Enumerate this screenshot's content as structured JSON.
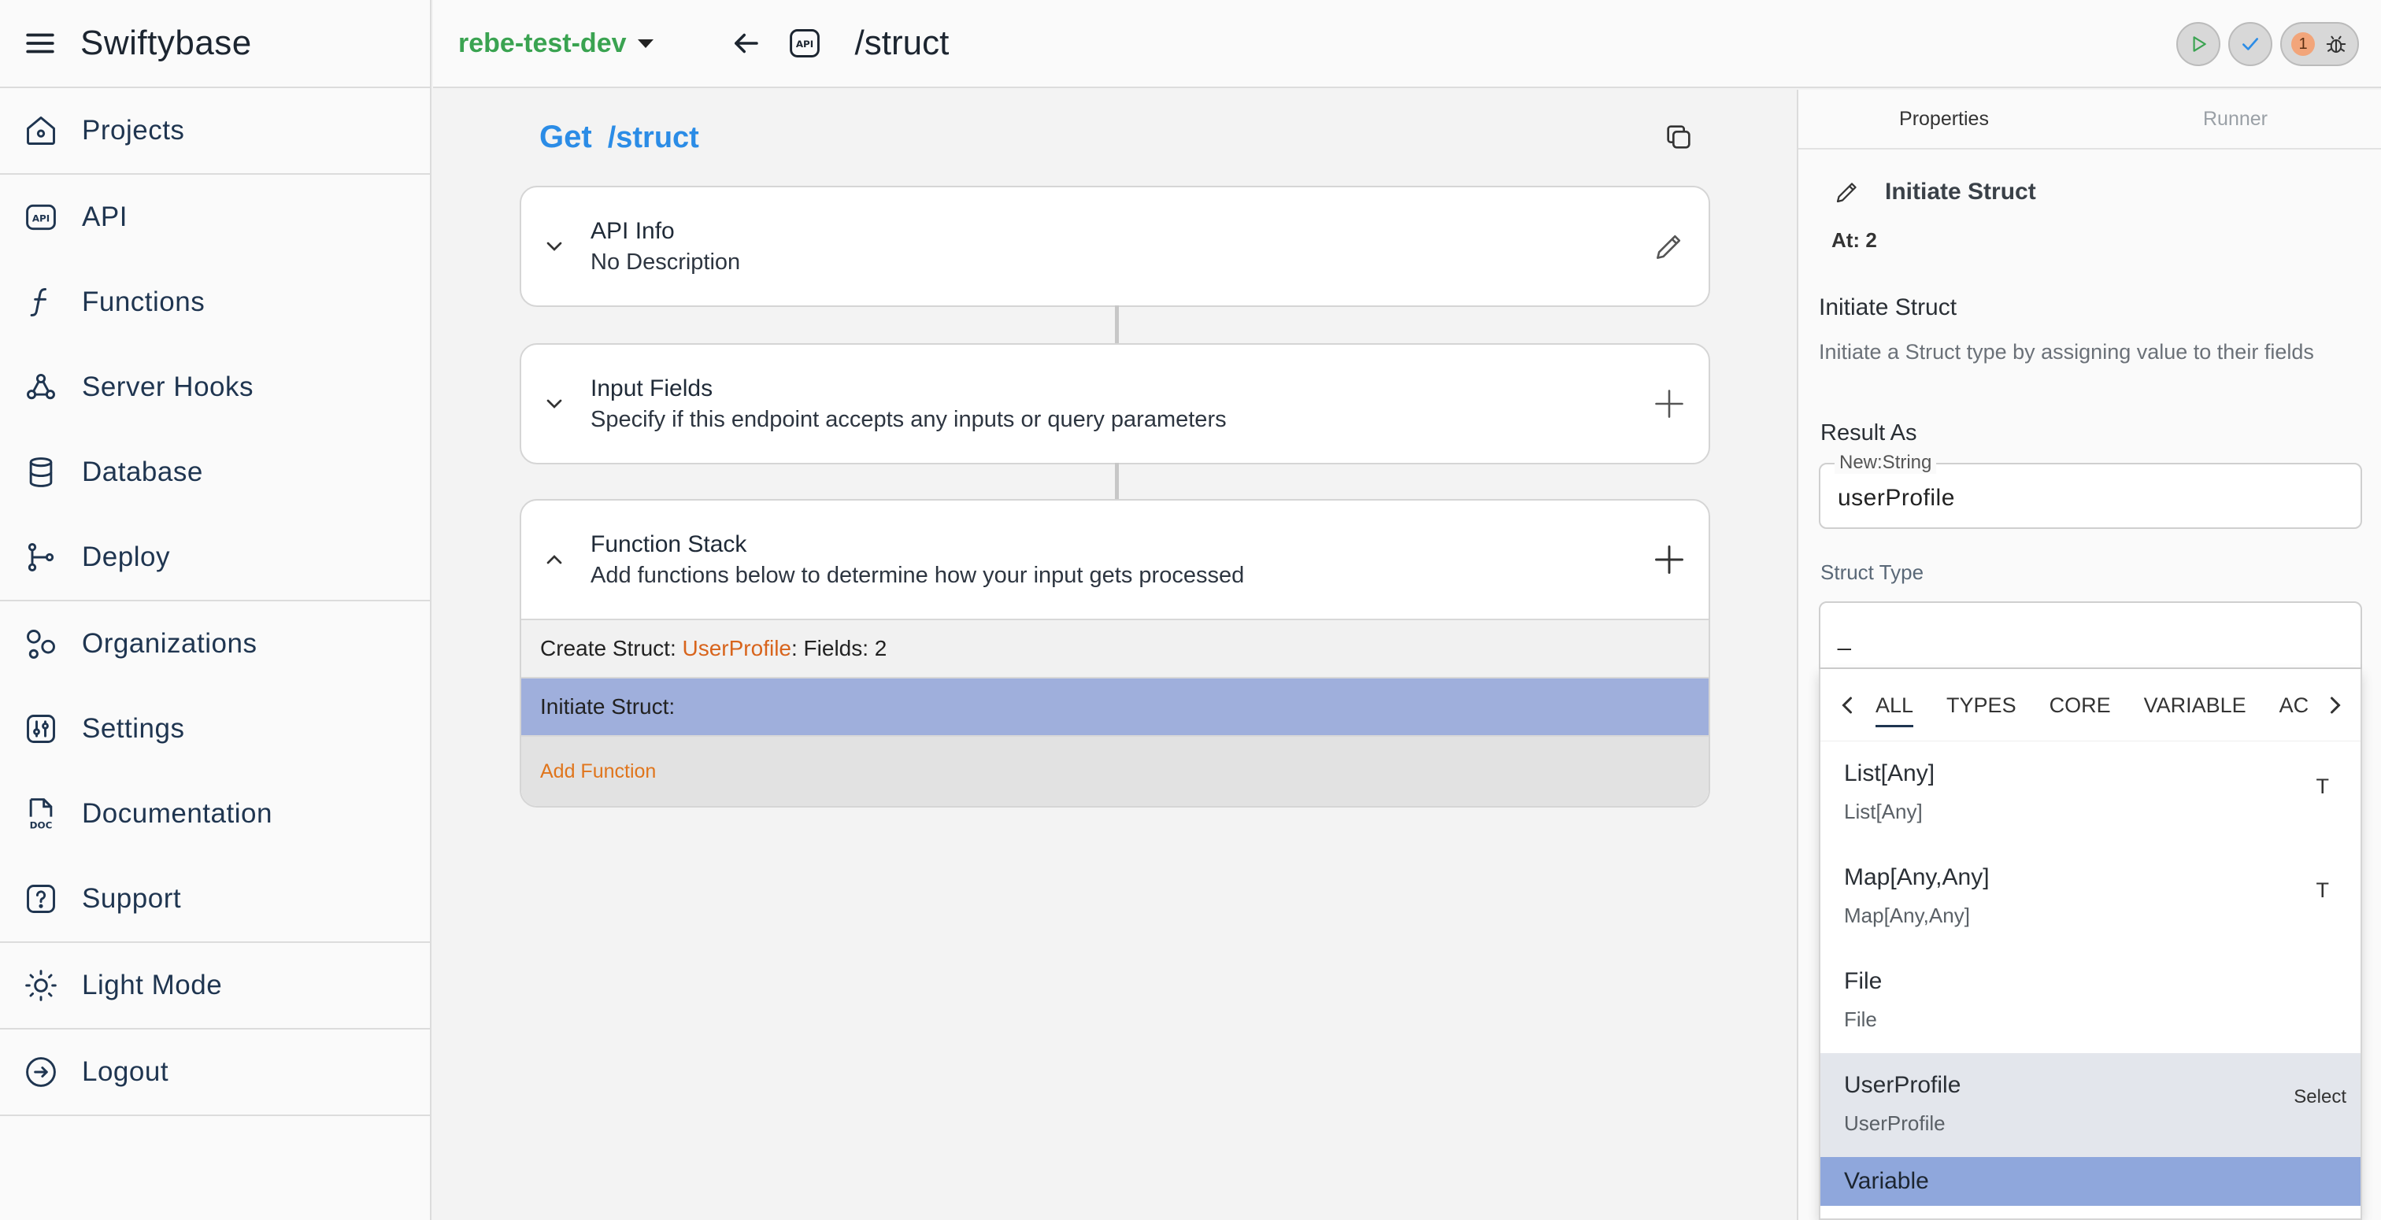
{
  "app": {
    "name": "Swiftybase"
  },
  "sidebar": {
    "items": [
      {
        "label": "Projects",
        "icon": "home-icon"
      },
      {
        "label": "API",
        "icon": "api-icon"
      },
      {
        "label": "Functions",
        "icon": "function-icon"
      },
      {
        "label": "Server Hooks",
        "icon": "webhook-icon"
      },
      {
        "label": "Database",
        "icon": "database-icon"
      },
      {
        "label": "Deploy",
        "icon": "git-branch-icon"
      },
      {
        "label": "Organizations",
        "icon": "organizations-icon"
      },
      {
        "label": "Settings",
        "icon": "settings-icon"
      },
      {
        "label": "Documentation",
        "icon": "doc-icon"
      },
      {
        "label": "Support",
        "icon": "help-icon"
      },
      {
        "label": "Light Mode",
        "icon": "sun-icon"
      },
      {
        "label": "Logout",
        "icon": "logout-icon"
      }
    ]
  },
  "topbar": {
    "environment": "rebe-test-dev",
    "path": "/struct",
    "notification_count": "1"
  },
  "endpoint": {
    "method": "Get",
    "path": "/struct"
  },
  "cards": {
    "api_info": {
      "title": "API Info",
      "subtitle": "No Description"
    },
    "input_fields": {
      "title": "Input Fields",
      "subtitle": "Specify if this endpoint accepts any inputs or query parameters"
    },
    "function_stack": {
      "title": "Function Stack",
      "subtitle": "Add functions below to determine how your input gets processed",
      "rows": {
        "create_prefix": "Create Struct: ",
        "create_struct_name": "UserProfile",
        "create_suffix": ": Fields: 2",
        "initiate": "Initiate Struct:"
      },
      "add_label": "Add Function"
    }
  },
  "panel": {
    "tabs": [
      "Properties",
      "Runner"
    ],
    "header_title": "Initiate Struct",
    "at": "At: 2",
    "function_name": "Initiate Struct",
    "function_desc": "Initiate a Struct type by assigning value to their fields",
    "result_label": "Result As",
    "result_legend": "New:String",
    "result_value": "userProfile",
    "struct_type_label": "Struct Type",
    "struct_type_value": "_",
    "dropdown": {
      "tabs": [
        "ALL",
        "TYPES",
        "CORE",
        "VARIABLE",
        "AC"
      ],
      "items": [
        {
          "name": "List[Any]",
          "sub": "List[Any]",
          "tag": "T"
        },
        {
          "name": "Map[Any,Any]",
          "sub": "Map[Any,Any]",
          "tag": "T"
        },
        {
          "name": "File",
          "sub": "File",
          "tag": ""
        },
        {
          "name": "UserProfile",
          "sub": "UserProfile",
          "tag": "Select"
        }
      ],
      "variable_label": "Variable"
    }
  },
  "colors": {
    "accent_blue": "#2b8ce6",
    "env_green": "#3aa351",
    "struct_orange": "#d8641c",
    "selected_row": "#9fafdc",
    "variable_highlight": "#8fa7dc"
  }
}
